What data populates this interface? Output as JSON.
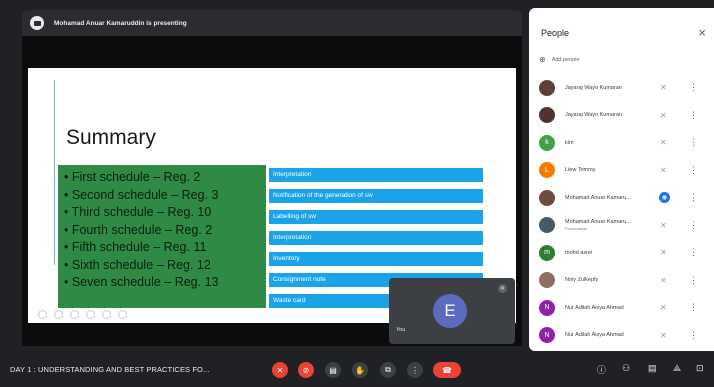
{
  "presenting": {
    "text": "Mohamad Anuar Kamaruddin is presenting"
  },
  "slide": {
    "title": "Summary",
    "left_items": [
      "• First schedule – Reg. 2",
      "• Second schedule – Reg. 3",
      "• Third schedule – Reg. 10",
      "• Fourth schedule – Reg. 2",
      "• Fifth schedule – Reg. 11",
      "• Sixth schedule – Reg. 12",
      "• Seven schedule – Reg. 13"
    ],
    "right_items": [
      "Interpretation",
      "Notification of the generation of sw",
      "Labelling of sw",
      "Interpretation",
      "Inventory",
      "Consignment note",
      "Waste card"
    ]
  },
  "self_view": {
    "initial": "E",
    "name": "You"
  },
  "people_panel": {
    "title": "People",
    "close": "×",
    "add_label": "Add people",
    "participants": [
      {
        "name": "Jayaraj Wayo Kumaran",
        "sub": "",
        "avatar": "",
        "color": "#5d4037"
      },
      {
        "name": "Jayaraj Wayo Kumaran",
        "sub": "",
        "avatar": "",
        "color": "#4e342e"
      },
      {
        "name": "kim",
        "sub": "",
        "avatar": "k",
        "color": "#43a047"
      },
      {
        "name": "Liew Tommy",
        "sub": "",
        "avatar": "L",
        "color": "#f57c00"
      },
      {
        "name": "Mohamad Anuar Kamaru...",
        "sub": "",
        "avatar": "",
        "color": "#6d4c41"
      },
      {
        "name": "Mohamad Anuar Kamaru...",
        "sub": "Presentation",
        "avatar": "",
        "color": "#455a64"
      },
      {
        "name": "mohd asrei",
        "sub": "",
        "avatar": "m",
        "color": "#2e7d32"
      },
      {
        "name": "Noly Zulkepfy",
        "sub": "",
        "avatar": "",
        "color": "#8d6e63"
      },
      {
        "name": "Nur Adilah Aisya Ahmad",
        "sub": "",
        "avatar": "N",
        "color": "#8e24aa"
      },
      {
        "name": "Nur Adilah Aisya Ahmad",
        "sub": "",
        "avatar": "N",
        "color": "#8e24aa"
      }
    ]
  },
  "toolbar": {
    "meeting_title": "DAY 1 : UNDERSTANDING AND BEST PRACTICES FO..."
  }
}
